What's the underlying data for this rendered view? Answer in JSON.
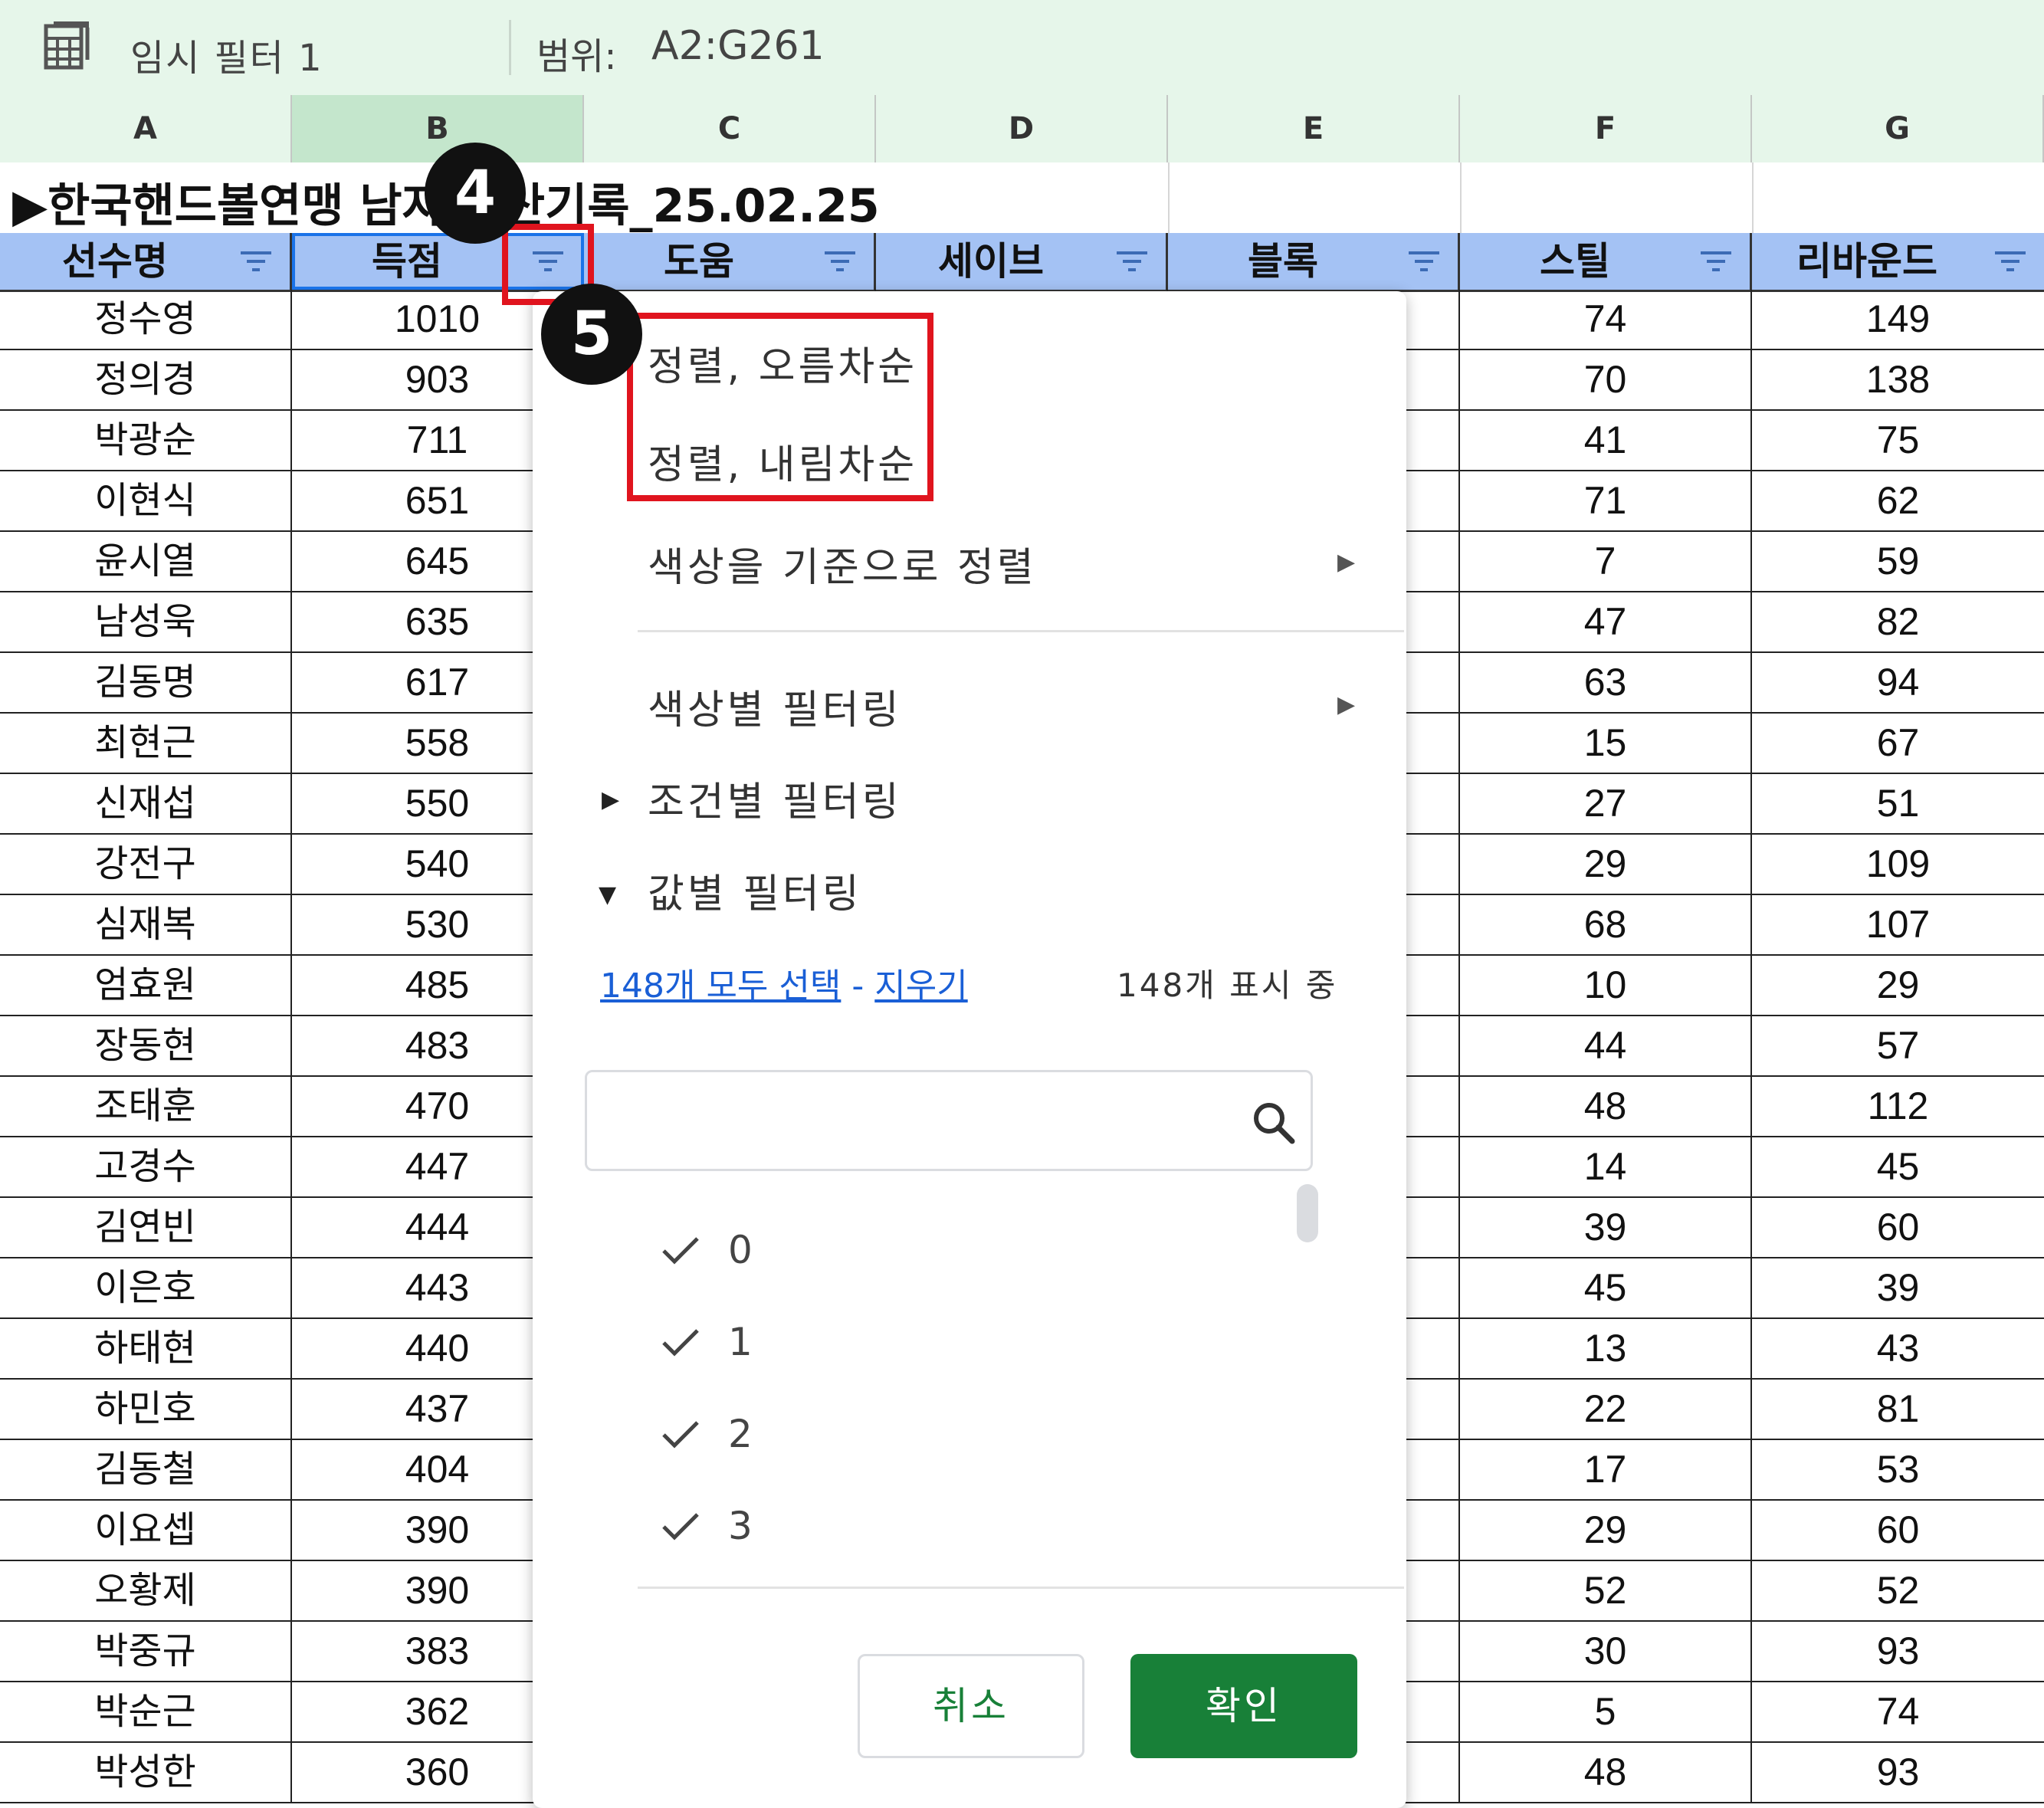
{
  "filter_bar": {
    "icon": "table-grid-icon",
    "name": "임시 필터 1",
    "range_label": "범위:",
    "range": "A2:G261"
  },
  "columns": [
    "A",
    "B",
    "C",
    "D",
    "E",
    "F",
    "G"
  ],
  "title": "▶한국핸드볼연맹 남자 통산기록_25.02.25",
  "headers": [
    "선수명",
    "득점",
    "도움",
    "세이브",
    "블록",
    "스틸",
    "리바운드"
  ],
  "rows": [
    {
      "name": "정수영",
      "score": "1010",
      "steal": "74",
      "rebound": "149"
    },
    {
      "name": "정의경",
      "score": "903",
      "steal": "70",
      "rebound": "138"
    },
    {
      "name": "박광순",
      "score": "711",
      "steal": "41",
      "rebound": "75"
    },
    {
      "name": "이현식",
      "score": "651",
      "steal": "71",
      "rebound": "62"
    },
    {
      "name": "윤시열",
      "score": "645",
      "steal": "7",
      "rebound": "59"
    },
    {
      "name": "남성욱",
      "score": "635",
      "steal": "47",
      "rebound": "82"
    },
    {
      "name": "김동명",
      "score": "617",
      "steal": "63",
      "rebound": "94"
    },
    {
      "name": "최현근",
      "score": "558",
      "steal": "15",
      "rebound": "67"
    },
    {
      "name": "신재섭",
      "score": "550",
      "steal": "27",
      "rebound": "51"
    },
    {
      "name": "강전구",
      "score": "540",
      "steal": "29",
      "rebound": "109"
    },
    {
      "name": "심재복",
      "score": "530",
      "steal": "68",
      "rebound": "107"
    },
    {
      "name": "엄효원",
      "score": "485",
      "steal": "10",
      "rebound": "29"
    },
    {
      "name": "장동현",
      "score": "483",
      "steal": "44",
      "rebound": "57"
    },
    {
      "name": "조태훈",
      "score": "470",
      "steal": "48",
      "rebound": "112"
    },
    {
      "name": "고경수",
      "score": "447",
      "steal": "14",
      "rebound": "45"
    },
    {
      "name": "김연빈",
      "score": "444",
      "steal": "39",
      "rebound": "60"
    },
    {
      "name": "이은호",
      "score": "443",
      "steal": "45",
      "rebound": "39"
    },
    {
      "name": "하태현",
      "score": "440",
      "steal": "13",
      "rebound": "43"
    },
    {
      "name": "하민호",
      "score": "437",
      "steal": "22",
      "rebound": "81"
    },
    {
      "name": "김동철",
      "score": "404",
      "steal": "17",
      "rebound": "53"
    },
    {
      "name": "이요셉",
      "score": "390",
      "steal": "29",
      "rebound": "60"
    },
    {
      "name": "오황제",
      "score": "390",
      "steal": "52",
      "rebound": "52"
    },
    {
      "name": "박중규",
      "score": "383",
      "steal": "30",
      "rebound": "93"
    },
    {
      "name": "박순근",
      "score": "362",
      "steal": "5",
      "rebound": "74"
    },
    {
      "name": "박성한",
      "score": "360",
      "steal": "48",
      "rebound": "93"
    }
  ],
  "menu": {
    "sort_asc": "정렬, 오름차순",
    "sort_desc": "정렬, 내림차순",
    "sort_by_color": "색상을 기준으로 정렬",
    "filter_by_color": "색상별 필터링",
    "filter_by_condition": "조건별 필터링",
    "filter_by_values": "값별 필터링",
    "select_all": "148개 모두 선택",
    "separator": "-",
    "clear": "지우기",
    "showing": "148개 표시 중",
    "search_placeholder": "",
    "values": [
      "0",
      "1",
      "2",
      "3"
    ],
    "cancel": "취소",
    "ok": "확인"
  },
  "annotations": {
    "badge_4": "4",
    "badge_5": "5"
  },
  "colors": {
    "filter_bar_bg": "#e6f6ea",
    "header_row_bg": "#a4c2f4",
    "selected_col_bg": "#c4e6cc",
    "ok_button": "#188038",
    "highlight_red": "#e0141e",
    "link_blue": "#1a5fd6"
  }
}
